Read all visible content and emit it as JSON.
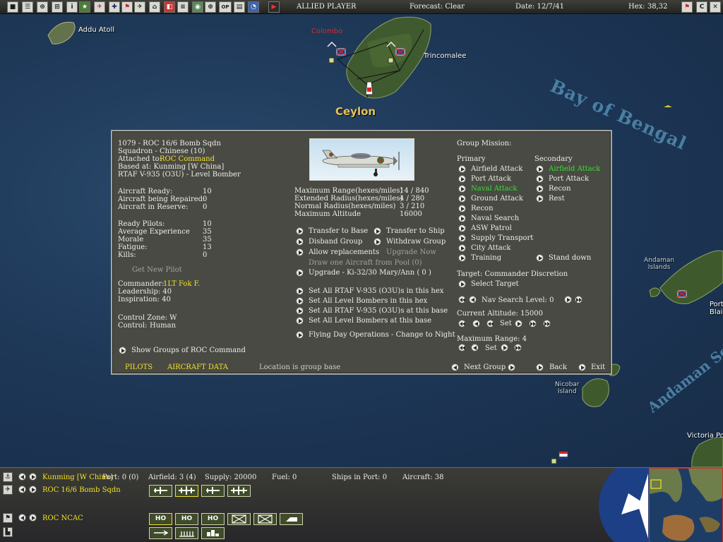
{
  "toolbar": {
    "player": "ALLIED PLAYER",
    "forecast": "Forecast: Clear",
    "date": "Date: 12/7/41",
    "hex": "Hex: 38,32",
    "buttons": [
      "save-icon",
      "document-icon",
      "task-force-icon",
      "lcu-icon",
      "info-icon",
      "star-icon",
      "aircraft-icon",
      "ship-icon",
      "flag-icon",
      "plane-icon",
      "base-icon",
      "toggle-icon",
      "ship-list-icon",
      "globe-icon",
      "magnify-icon",
      "op-icon",
      "report-icon",
      "cycle-icon",
      "end-turn-icon"
    ],
    "op_label": "OP",
    "info_label": "i",
    "c_label": "C"
  },
  "map": {
    "labels": {
      "addu": "Addu Atoll",
      "colombo": "Colombo",
      "trincomalee": "Trincomalee",
      "ceylon": "Ceylon",
      "bay": "Bay of Bengal",
      "andaman_islands": "Andaman\nIslands",
      "nicobar_island": "Nicobar\nIsland",
      "port_blair": "Port\nBlair",
      "victoria_point": "Victoria Po",
      "andaman_sea": "Andaman Se"
    }
  },
  "panel": {
    "group_title": "1079 - ROC 16/6 Bomb Sqdn",
    "squadron": "Squadron - Chinese (10)",
    "attached_label": "Attached to:",
    "attached_value": "ROC Command",
    "based_at": "Based at: Kunming [W China]",
    "aircraft_type": "RTAF V-935 (O3U) - Level Bomber",
    "stats": [
      {
        "label": "Aircraft Ready:",
        "value": "10"
      },
      {
        "label": "Aircraft being Repaired:",
        "value": "0"
      },
      {
        "label": "Aircraft in Reserve:",
        "value": "0"
      }
    ],
    "pilot_stats": [
      {
        "label": "Ready Pilots:",
        "value": "10"
      },
      {
        "label": "Average Experience",
        "value": "35"
      },
      {
        "label": "Morale",
        "value": "35"
      },
      {
        "label": "Fatigue:",
        "value": "13"
      },
      {
        "label": "Kills:",
        "value": "0"
      }
    ],
    "get_new_pilot": "Get New Pilot",
    "commander_label": "Commander:",
    "commander_value": "1LT Fok F.",
    "leadership": "Leadership: 40",
    "inspiration": "Inspiration: 40",
    "control_zone": "Control Zone: W",
    "control_label": "Control:",
    "control_value": "Human",
    "show_groups": "Show Groups of ROC Command",
    "range_stats": [
      {
        "label": "Maximum Range(hexes/miles)",
        "value": "14 / 840"
      },
      {
        "label": "Extended Radius(hexes/miles)",
        "value": "4 / 280"
      },
      {
        "label": "Normal Radius(hexes/miles)",
        "value": "3 / 210"
      },
      {
        "label": "Maximum Altitude",
        "value": "16000"
      }
    ],
    "actions": {
      "transfer_to_base": "Transfer to Base",
      "transfer_to_ship": "Transfer to Ship",
      "disband_group": "Disband Group",
      "withdraw_group": "Withdraw Group",
      "allow_replacements": "Allow replacements",
      "upgrade_now": "Upgrade Now",
      "draw_one": "Draw one Aircraft from Pool (0)",
      "upgrade": "Upgrade - Ki-32/30 Mary/Ann  ( 0 )",
      "set_all_rtaf_hex": "Set All RTAF V-935 (O3U)s in this hex",
      "set_all_level_hex": "Set All Level Bombers in this hex",
      "set_all_rtaf_base": "Set All RTAF V-935 (O3U)s at this base",
      "set_all_level_base": "Set All Level Bombers at this base",
      "flying_day": "Flying Day Operations - Change to Night"
    },
    "mission": {
      "title": "Group Mission:",
      "primary_label": "Primary",
      "secondary_label": "Secondary",
      "primary": [
        "Airfield Attack",
        "Port Attack",
        "Naval Attack",
        "Ground Attack",
        "Recon",
        "Naval Search",
        "ASW Patrol",
        "Supply Transport",
        "City Attack",
        "Training"
      ],
      "primary_selected": "Naval Attack",
      "secondary": [
        "Airfield Attack",
        "Port Attack",
        "Recon",
        "Rest"
      ],
      "secondary_selected": "Airfield Attack",
      "stand_down": "Stand down",
      "target": "Target: Commander Discretion",
      "select_target": "Select Target",
      "nav_search": "Nav Search Level: 0",
      "current_altitude": "Current Altitude: 15000",
      "set_label": "Set",
      "max_range": "Maximum Range: 4"
    },
    "footer": {
      "pilots": "PILOTS",
      "aircraft_data": "AIRCRAFT DATA",
      "location": "Location is group base",
      "next_group": "Next Group",
      "back": "Back",
      "exit": "Exit"
    }
  },
  "bottombar": {
    "base_name": "Kunming [W China]",
    "port": "Port: 0 (0)",
    "airfield": "Airfield: 3 (4)",
    "supply": "Supply: 20000",
    "fuel": "Fuel: 0",
    "ships_in_port": "Ships in Port: 0",
    "aircraft": "Aircraft: 38",
    "unit_name": "ROC 16/6 Bomb Sqdn",
    "hq_name": "ROC NCAC",
    "ho_label": "HO"
  }
}
